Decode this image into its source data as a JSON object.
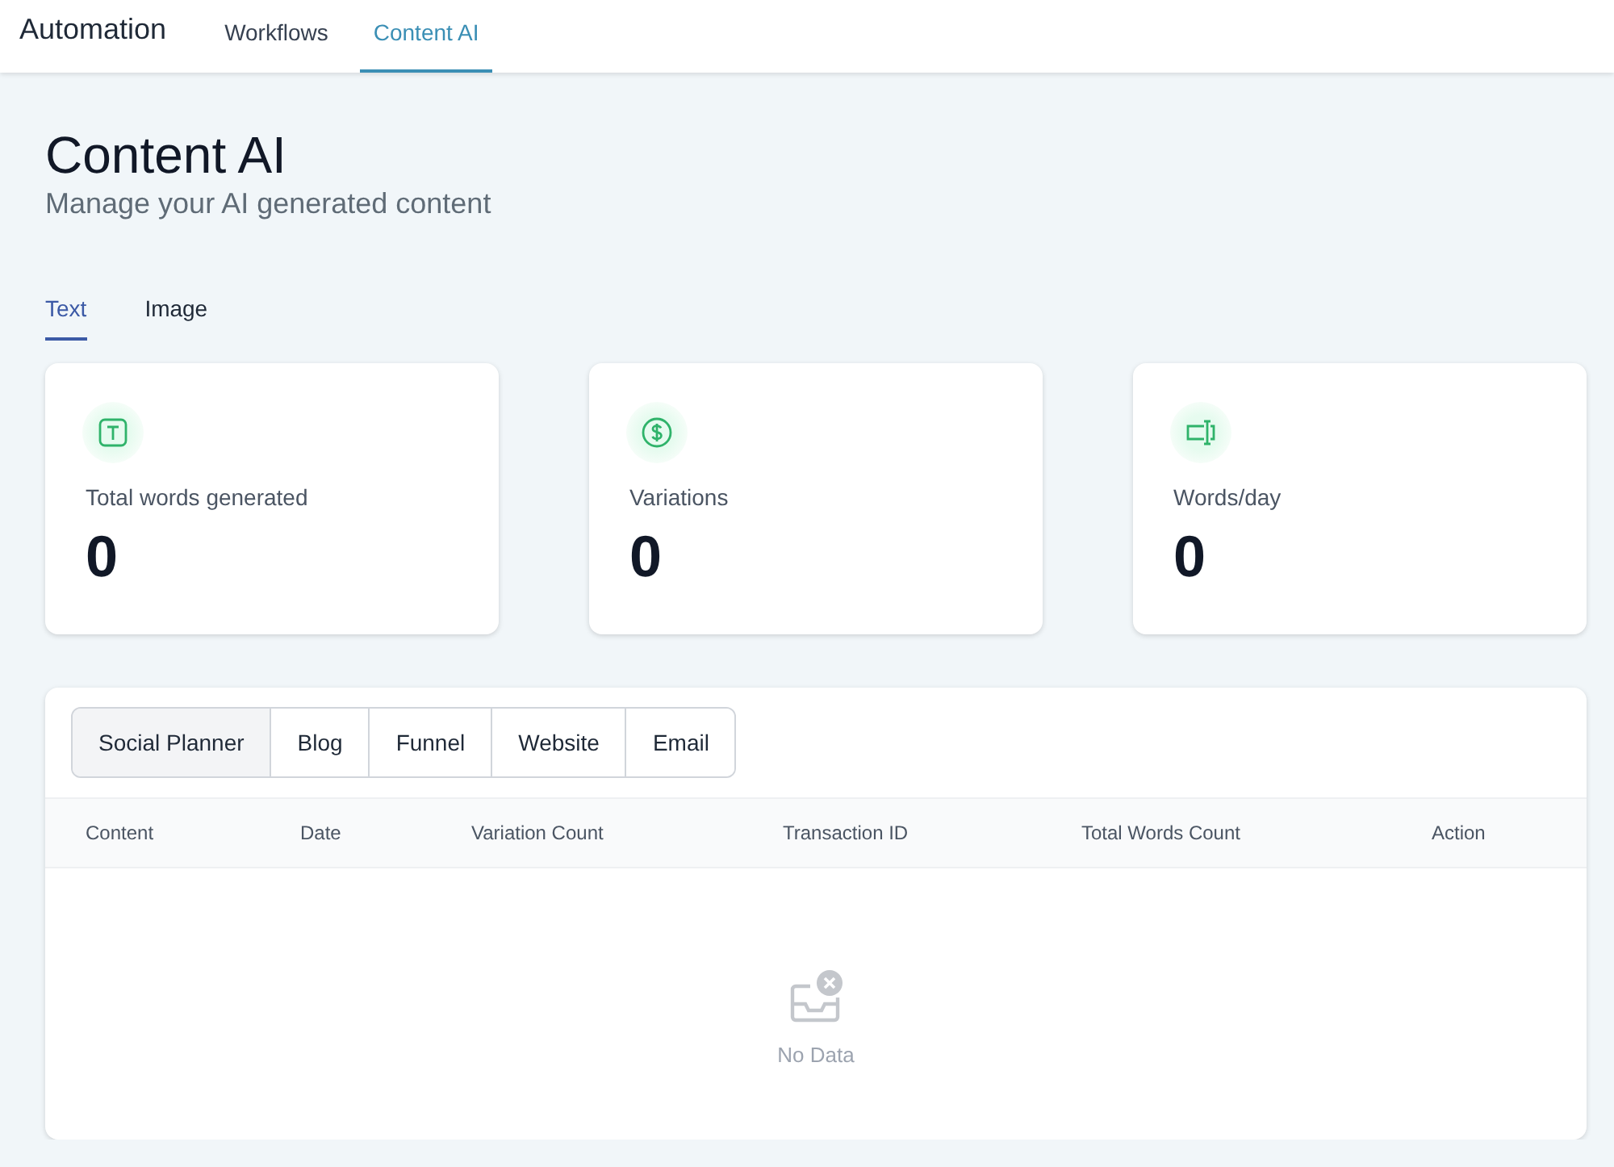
{
  "nav": {
    "title": "Automation",
    "tabs": [
      {
        "label": "Workflows",
        "selected": false
      },
      {
        "label": "Content AI",
        "selected": true
      }
    ]
  },
  "header": {
    "title": "Content AI",
    "subtitle": "Manage your AI generated content"
  },
  "content_tabs": [
    {
      "label": "Text",
      "selected": true
    },
    {
      "label": "Image",
      "selected": false
    }
  ],
  "stats": [
    {
      "kind": "text",
      "label": "Total words generated",
      "value": "0"
    },
    {
      "kind": "dollar",
      "label": "Variations",
      "value": "0"
    },
    {
      "kind": "cursor",
      "label": "Words/day",
      "value": "0"
    }
  ],
  "table": {
    "segments": [
      {
        "label": "Social Planner",
        "selected": true
      },
      {
        "label": "Blog",
        "selected": false
      },
      {
        "label": "Funnel",
        "selected": false
      },
      {
        "label": "Website",
        "selected": false
      },
      {
        "label": "Email",
        "selected": false
      }
    ],
    "columns": [
      "Content",
      "Date",
      "Variation Count",
      "Transaction ID",
      "Total Words Count",
      "Action"
    ],
    "empty": "No Data"
  }
}
